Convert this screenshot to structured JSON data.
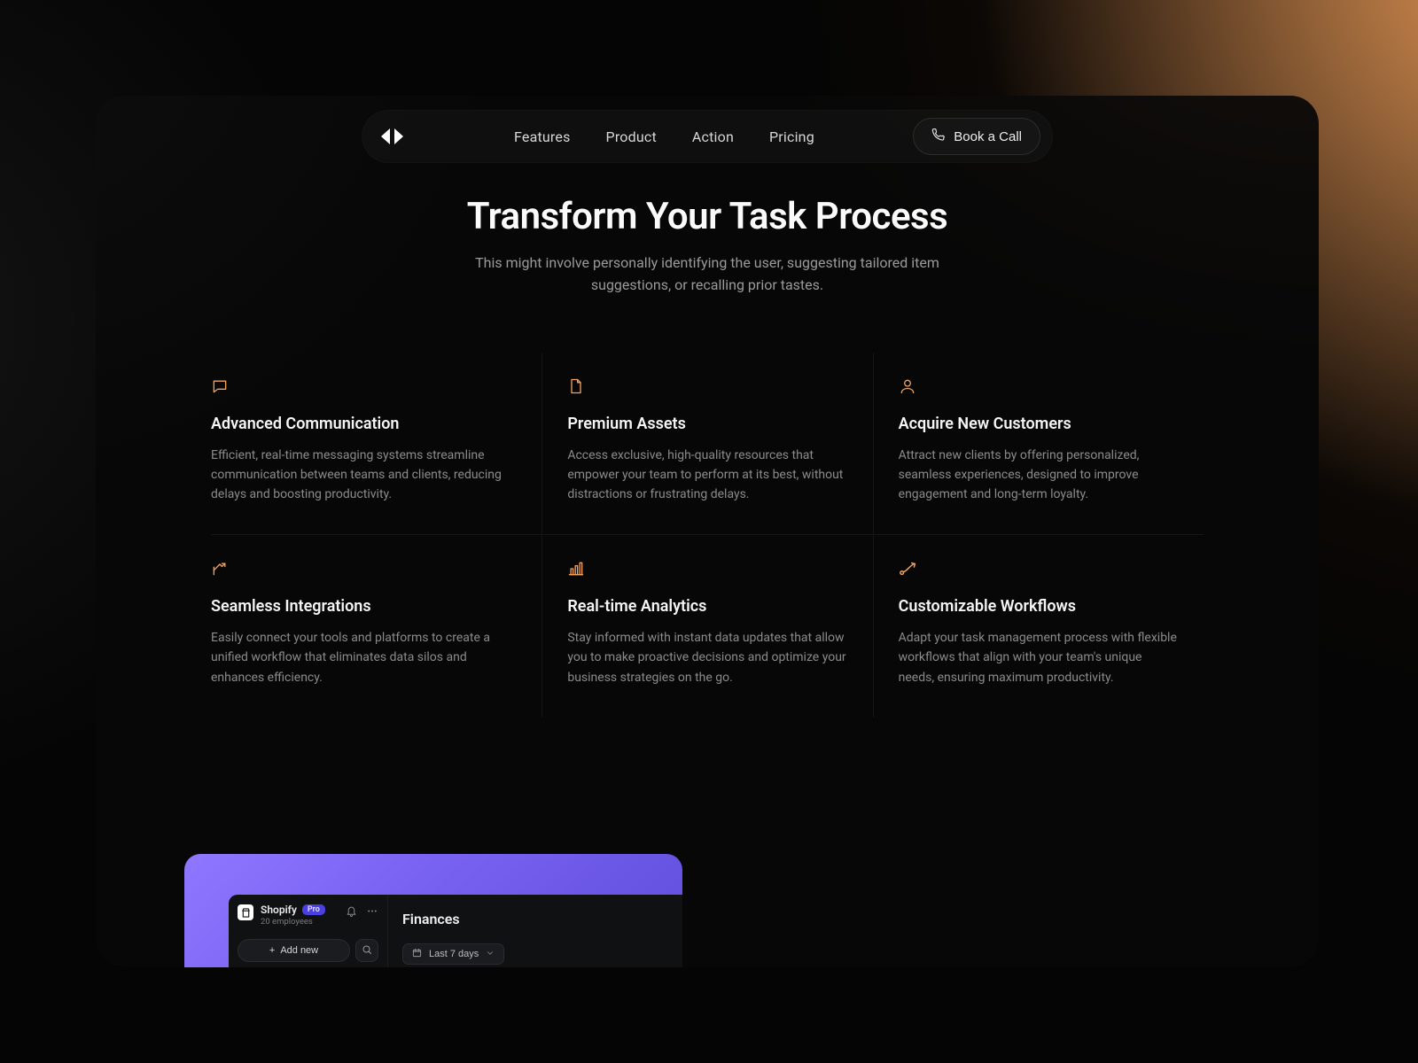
{
  "colors": {
    "accent": "#f2a25c",
    "accent2": "#7a63f3"
  },
  "nav": {
    "items": [
      "Features",
      "Product",
      "Action",
      "Pricing"
    ],
    "cta": "Book a Call"
  },
  "hero": {
    "title": "Transform Your Task Process",
    "subtitle_l1": "This might involve personally identifying the user, suggesting tailored item",
    "subtitle_l2": "suggestions, or recalling prior tastes."
  },
  "features": [
    {
      "icon": "chat-icon",
      "title": "Advanced Communication",
      "desc": "Efficient, real-time messaging systems streamline communication between teams and clients, reducing delays and boosting productivity."
    },
    {
      "icon": "file-icon",
      "title": "Premium Assets",
      "desc": "Access exclusive, high-quality resources that empower your team to perform at its best, without distractions or frustrating delays."
    },
    {
      "icon": "user-icon",
      "title": "Acquire New Customers",
      "desc": "Attract new clients by offering personalized, seamless experiences, designed to improve engagement and long-term loyalty."
    },
    {
      "icon": "share-icon",
      "title": "Seamless Integrations",
      "desc": "Easily connect your tools and platforms to create a unified workflow that eliminates data silos and enhances efficiency."
    },
    {
      "icon": "barchart-icon",
      "title": "Real-time Analytics",
      "desc": "Stay informed with instant data updates that allow you to make proactive decisions and optimize your business strategies on the go."
    },
    {
      "icon": "path-icon",
      "title": "Customizable Workflows",
      "desc": "Adapt your task management process with flexible workflows that align with your team's unique needs, ensuring maximum productivity."
    }
  ],
  "preview": {
    "brand": "Shopify",
    "badge": "Pro",
    "sub": "20 employees",
    "add": "Add new",
    "section": "Finances",
    "range": "Last 7 days"
  }
}
